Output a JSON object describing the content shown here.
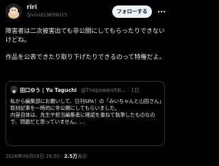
{
  "post": {
    "author": {
      "display_name": "riri",
      "handle": "@vivid13839015"
    },
    "follow_label": "フォローする",
    "text_paragraphs": [
      "障害者は二次被害出ても非公開にしてもらったりできないけどね。",
      "作品を公表できたり取り下げたりできるのって特権だよ。"
    ],
    "quoted": {
      "display_name": "田口ゆう | Yu Taguchi",
      "handle": "@Thepowerofdi…",
      "separator": "·",
      "age": "1日",
      "text": "私から編集部にお願いして、日刊SPA！の「みいちゃんと山田さん」取材記事を一時的に非公開にしてもらいました。\n内容自体は、先生や担当編集者に確認を重ねて執筆したものなので、問題だと思っていません。…"
    },
    "footer": {
      "timestamp": "2026年08月03日 16:50",
      "separator": "·",
      "views_count": "2.5万",
      "views_label": "表示"
    }
  },
  "colors": {
    "background": "#000000",
    "text": "#e7e9ea",
    "muted": "#71767b",
    "border": "#2f3336",
    "button_bg": "#eff3f4"
  }
}
